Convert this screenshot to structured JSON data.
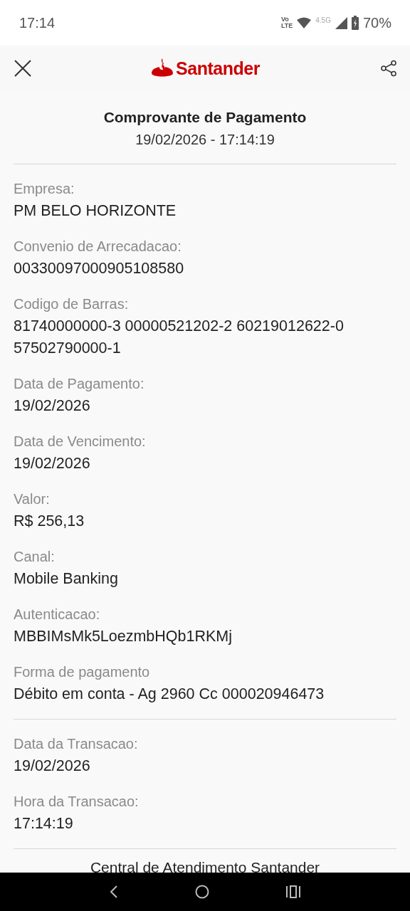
{
  "status_bar": {
    "time": "17:14",
    "volte": [
      "Vo",
      "LTE"
    ],
    "network": "4.5G",
    "battery": "70%"
  },
  "header": {
    "brand": "Santander"
  },
  "receipt": {
    "title": "Comprovante de Pagamento",
    "timestamp": "19/02/2026 - 17:14:19",
    "sections": [
      {
        "fields": [
          {
            "label": "Empresa:",
            "value": "PM BELO HORIZONTE"
          },
          {
            "label": "Convenio de Arrecadacao:",
            "value": "00330097000905108580"
          },
          {
            "label": "Codigo de Barras:",
            "value": "81740000000-3 00000521202-2 60219012622-0 57502790000-1"
          },
          {
            "label": "Data de Pagamento:",
            "value": "19/02/2026"
          },
          {
            "label": "Data de Vencimento:",
            "value": "19/02/2026"
          },
          {
            "label": "Valor:",
            "value": "R$ 256,13"
          },
          {
            "label": "Canal:",
            "value": "Mobile Banking"
          },
          {
            "label": "Autenticacao:",
            "value": "MBBIMsMk5LoezmbHQb1RKMj"
          },
          {
            "label": "Forma de pagamento",
            "value": "Débito em conta - Ag 2960 Cc 000020946473"
          }
        ]
      },
      {
        "fields": [
          {
            "label": "Data da Transacao:",
            "value": "19/02/2026"
          },
          {
            "label": "Hora da Transacao:",
            "value": "17:14:19"
          }
        ]
      }
    ],
    "footer": "Central de Atendimento Santander"
  }
}
